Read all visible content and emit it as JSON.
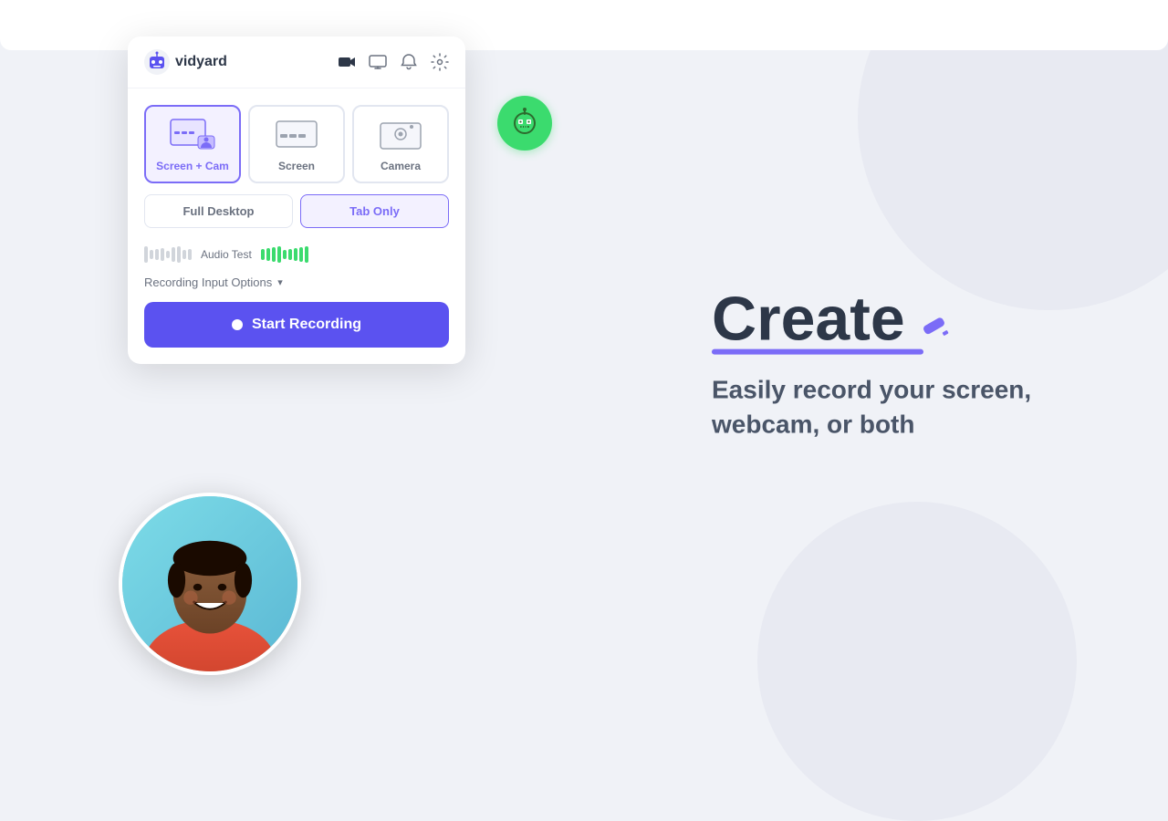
{
  "app": {
    "title": "Vidyard",
    "logo_text": "vidyard"
  },
  "header": {
    "icons": [
      "video-camera",
      "screen",
      "bell",
      "settings"
    ]
  },
  "modes": [
    {
      "id": "screen-cam",
      "label": "Screen + Cam",
      "active": true
    },
    {
      "id": "screen",
      "label": "Screen",
      "active": false
    },
    {
      "id": "camera",
      "label": "Camera",
      "active": false
    }
  ],
  "sub_modes": [
    {
      "id": "full-desktop",
      "label": "Full Desktop",
      "active": false
    },
    {
      "id": "tab-only",
      "label": "Tab Only",
      "active": true
    }
  ],
  "audio": {
    "label": "Audio Test"
  },
  "input_options": {
    "label": "Recording Input Options"
  },
  "start_button": {
    "label": "Start Recording"
  },
  "hero": {
    "title": "Create",
    "subtitle": "Easily record your screen, webcam, or both"
  }
}
